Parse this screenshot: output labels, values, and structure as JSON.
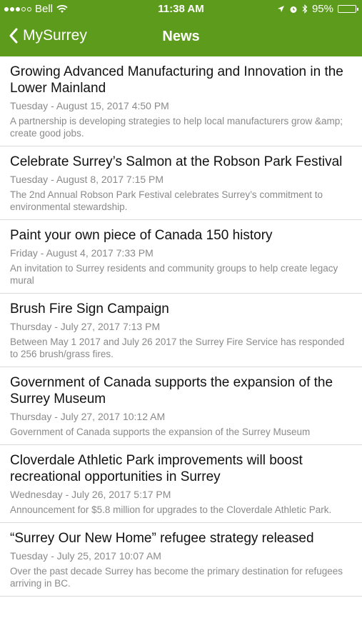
{
  "status_bar": {
    "carrier": "Bell",
    "time": "11:38 AM",
    "battery": "95%",
    "icons": [
      "signal-dots-icon",
      "wifi-icon",
      "location-icon",
      "alarm-icon",
      "bluetooth-icon",
      "battery-icon"
    ]
  },
  "nav": {
    "back_label": "MySurrey",
    "title": "News"
  },
  "colors": {
    "accent": "#5d9b1c"
  },
  "news": [
    {
      "title": "Growing Advanced Manufacturing and Innovation in the Lower Mainland",
      "date": "Tuesday - August 15, 2017 4:50 PM",
      "desc": "A partnership is developing strategies to help local manufacturers grow &amp; create good jobs."
    },
    {
      "title": "Celebrate Surrey’s Salmon at the Robson Park Festival",
      "date": "Tuesday - August 8, 2017 7:15 PM",
      "desc": "The 2nd Annual Robson Park Festival celebrates Surrey’s commitment to environmental stewardship."
    },
    {
      "title": "Paint your own piece of Canada 150 history",
      "date": "Friday - August 4, 2017 7:33 PM",
      "desc": "An invitation to Surrey residents and community groups to help create legacy mural"
    },
    {
      "title": "Brush Fire Sign Campaign",
      "date": "Thursday - July 27, 2017 7:13 PM",
      "desc": "Between May 1 2017 and July 26 2017 the Surrey Fire Service has responded to 256 brush/grass fires."
    },
    {
      "title": "Government of Canada supports the expansion of the Surrey Museum",
      "date": "Thursday - July 27, 2017 10:12 AM",
      "desc": "Government of Canada supports the expansion of the Surrey Museum"
    },
    {
      "title": "Cloverdale Athletic Park improvements will boost recreational opportunities in Surrey",
      "date": "Wednesday - July 26, 2017 5:17 PM",
      "desc": "Announcement for $5.8 million for upgrades to the Cloverdale Athletic Park."
    },
    {
      "title": "“Surrey Our New Home” refugee strategy released",
      "date": "Tuesday - July 25, 2017 10:07 AM",
      "desc": "Over the past decade Surrey has become the primary destination for refugees arriving in BC."
    }
  ]
}
